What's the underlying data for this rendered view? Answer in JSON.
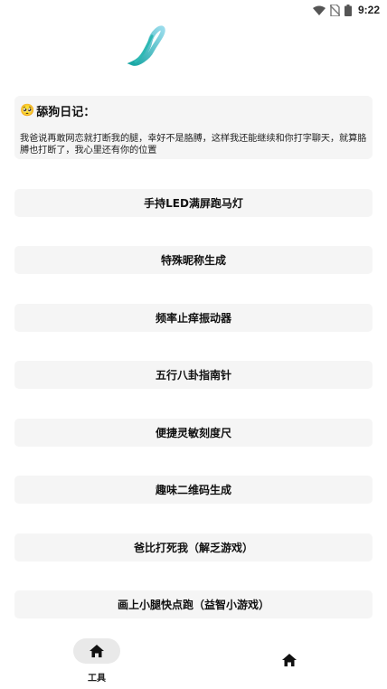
{
  "status_bar": {
    "time": "9:22"
  },
  "diary": {
    "emoji": "🥺",
    "title": "舔狗日记：",
    "text": "我爸说再敢网恋就打断我的腿，幸好不是胳膊，这样我还能继续和你打字聊天，就算胳膊也打断了，我心里还有你的位置"
  },
  "tools": [
    {
      "label": "手持LED满屏跑马灯"
    },
    {
      "label": "特殊昵称生成"
    },
    {
      "label": "频率止痒振动器"
    },
    {
      "label": "五行八卦指南针"
    },
    {
      "label": "便捷灵敏刻度尺"
    },
    {
      "label": "趣味二维码生成"
    },
    {
      "label": "爸比打死我（解乏游戏）"
    },
    {
      "label": "画上小腿快点跑（益智小游戏）"
    }
  ],
  "bottom_nav": {
    "tools_label": "工具",
    "tools_icon": "home-icon",
    "home_icon": "home-icon"
  },
  "colors": {
    "card_bg": "#f5f5f5",
    "logo_gradient_start": "#22b5b0",
    "logo_gradient_end": "#8fd9e8"
  }
}
